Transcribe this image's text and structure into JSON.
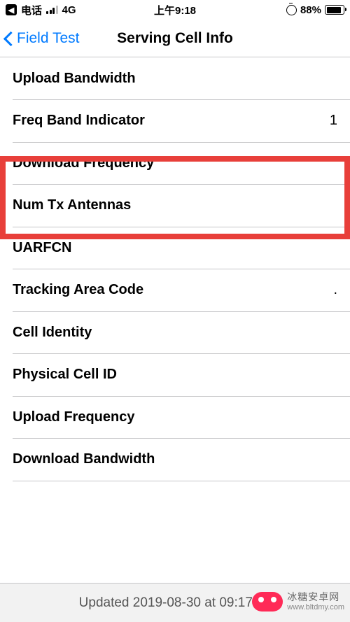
{
  "statusBar": {
    "carrier": "电话",
    "network": "4G",
    "time": "上午9:18",
    "batteryPercent": "88%"
  },
  "nav": {
    "back": "Field Test",
    "title": "Serving Cell Info"
  },
  "rows": [
    {
      "label": "Upload Bandwidth",
      "value": ""
    },
    {
      "label": "Freq Band Indicator",
      "value": "1"
    },
    {
      "label": "Download Frequency",
      "value": ""
    },
    {
      "label": "Num Tx Antennas",
      "value": ""
    },
    {
      "label": "UARFCN",
      "value": ""
    },
    {
      "label": "Tracking Area Code",
      "value": "."
    },
    {
      "label": "Cell Identity",
      "value": ""
    },
    {
      "label": "Physical Cell ID",
      "value": ""
    },
    {
      "label": "Upload Frequency",
      "value": ""
    },
    {
      "label": "Download Bandwidth",
      "value": ""
    }
  ],
  "footer": {
    "text": "Updated 2019-08-30 at 09:17:47"
  },
  "watermark": {
    "cn": "冰糖安卓网",
    "url": "www.bltdmy.com"
  }
}
